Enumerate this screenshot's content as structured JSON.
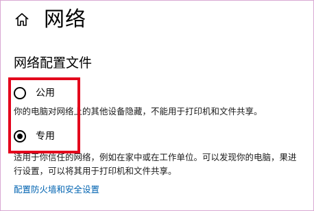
{
  "page": {
    "title": "网络",
    "home_icon": "home-icon"
  },
  "section": {
    "title": "网络配置文件"
  },
  "profiles": [
    {
      "label": "公用",
      "selected": false,
      "description": "你的电脑对网络上的其他设备隐藏，不能用于打印机和文件共享。"
    },
    {
      "label": "专用",
      "selected": true,
      "description": "适用于你信任的网络，例如在家中或在工作单位。可以发现你的电脑，果进行设置，可以将其用于打印机和文件共享。"
    }
  ],
  "link": {
    "label": "配置防火墙和安全设置"
  },
  "colors": {
    "link": "#0063b1",
    "highlight": "#e3001b",
    "frame": "#d9a7d3"
  }
}
